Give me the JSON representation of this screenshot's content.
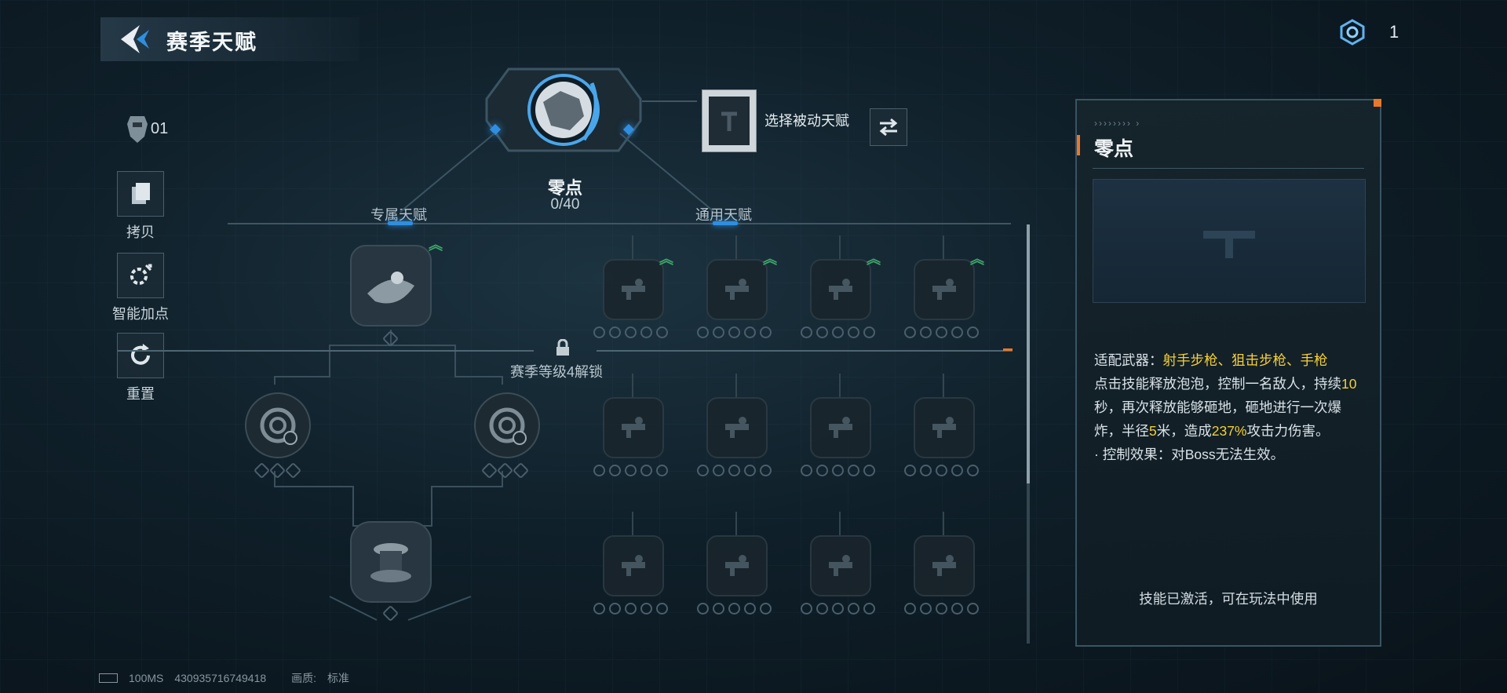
{
  "header": {
    "title": "赛季天赋"
  },
  "currency": {
    "icon": "hexagon-token-icon",
    "count": "1"
  },
  "sidebar": {
    "character_number": "01",
    "items": [
      {
        "label": "拷贝",
        "icon": "copy-icon"
      },
      {
        "label": "智能加点",
        "icon": "auto-assign-icon"
      },
      {
        "label": "重置",
        "icon": "reset-icon"
      }
    ]
  },
  "talent_core": {
    "name": "零点",
    "points": "0/40",
    "passive_label": "选择被动天赋"
  },
  "tabs": [
    {
      "label": "专属天赋",
      "active": true
    },
    {
      "label": "通用天赋",
      "active": true
    }
  ],
  "lock": {
    "text": "赛季等级4解锁"
  },
  "panel": {
    "title": "零点",
    "weapons_label": "适配武器：",
    "weapons_value": "射手步枪、狙击步枪、手枪",
    "desc_1": "点击技能释放泡泡，控制一名敌人，持续",
    "duration": "10",
    "desc_2": "秒，再次释放能够砸地，砸地进行一次爆炸，半径",
    "radius": "5",
    "desc_3": "米，造成",
    "damage": "237%",
    "desc_4": "攻击力伤害。",
    "note": "· 控制效果：对Boss无法生效。",
    "footer": "技能已激活，可在玩法中使用"
  },
  "status": {
    "ping": "100MS",
    "uid": "430935716749418",
    "quality_label": "画质:",
    "quality_value": "标准"
  },
  "colors": {
    "accent_blue": "#2f8ee0",
    "highlight_yellow": "#f4cf38",
    "accent_orange": "#e9782a",
    "upgrade_green": "#3ea86a"
  }
}
